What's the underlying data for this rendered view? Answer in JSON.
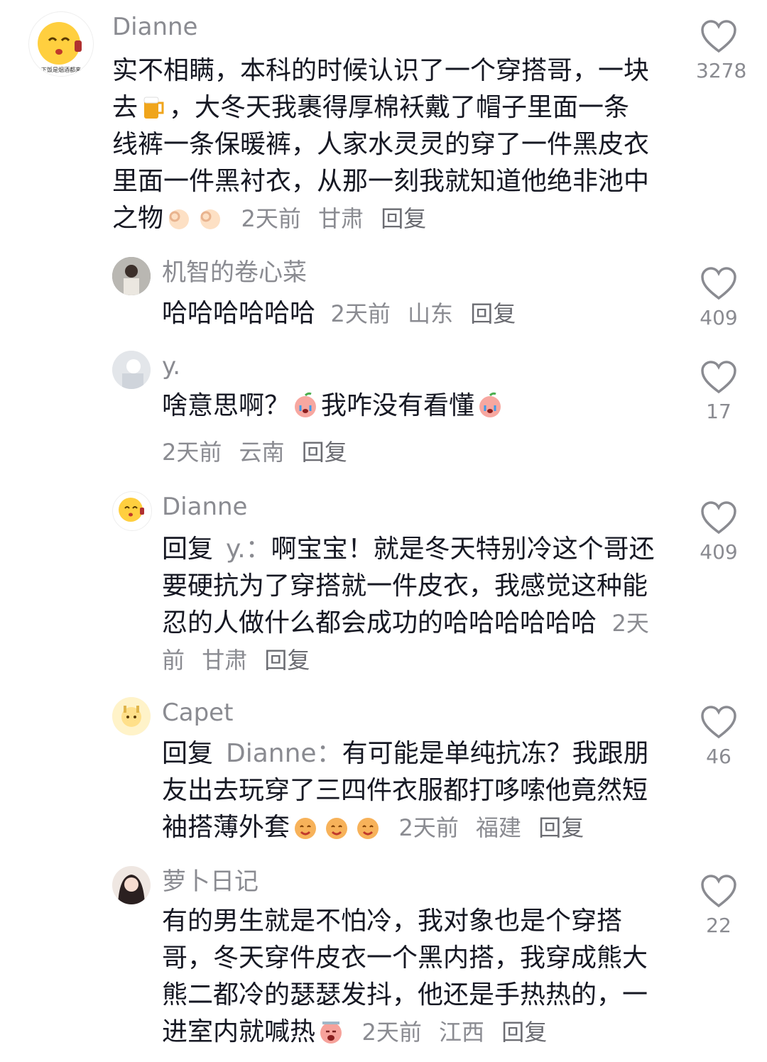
{
  "comments": [
    {
      "user": "Dianne",
      "avatar_caption": "下饭是烟酒都来",
      "text": "实不相瞒，本科的时候认识了一个穿搭哥，一块去",
      "text2": "，大冬天我裹得厚棉袄戴了帽子里面一条线裤一条保暖裤，人家水灵灵的穿了一件黑皮衣里面一件黑衬衣，从那一刻我就知道他绝非池中之物",
      "emoji1": "beer-icon",
      "emoji2": "ok-hand-icon",
      "time": "2天前",
      "location": "甘肃",
      "reply": "回复",
      "likes": "3278",
      "replies": [
        {
          "user": "机智的卷心菜",
          "text": "哈哈哈哈哈哈",
          "time": "2天前",
          "location": "山东",
          "reply": "回复",
          "likes": "409"
        },
        {
          "user": "y.",
          "text": "啥意思啊？",
          "text2": "我咋没有看懂",
          "emoji": "crying-peach-icon",
          "time": "2天前",
          "location": "云南",
          "reply": "回复",
          "likes": "17"
        },
        {
          "user": "Dianne",
          "reply_prefix": "回复",
          "reply_to": "y.：",
          "text": "啊宝宝！就是冬天特别冷这个哥还要硬抗为了穿搭就一件皮衣，我感觉这种能忍的人做什么都会成功的哈哈哈哈哈哈",
          "time": "2天前",
          "location": "甘肃",
          "reply": "回复",
          "likes": "409"
        },
        {
          "user": "Capet",
          "reply_prefix": "回复",
          "reply_to": "Dianne：",
          "text": "有可能是单纯抗冻？我跟朋友出去玩穿了三四件衣服都打哆嗦他竟然短袖搭薄外套",
          "emoji": "smiling-peach-icon",
          "time": "2天前",
          "location": "福建",
          "reply": "回复",
          "likes": "46"
        },
        {
          "user": "萝卜日记",
          "text": "有的男生就是不怕冷，我对象也是个穿搭哥，冬天穿件皮衣一个黑内搭，我穿成熊大熊二都冷的瑟瑟发抖，他还是手热热的，一进室内就喊热",
          "emoji": "hot-face-icon",
          "time": "2天前",
          "location": "江西",
          "reply": "回复",
          "likes": "22"
        }
      ]
    }
  ],
  "colors": {
    "text": "#161823",
    "meta": "#8a8b91",
    "heart_stroke": "#8a8b91"
  }
}
